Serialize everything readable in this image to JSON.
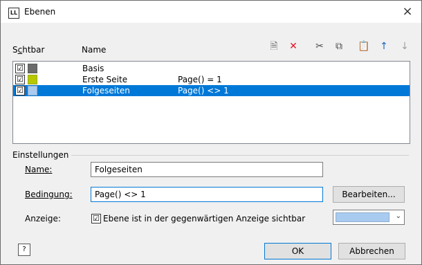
{
  "window": {
    "title": "Ebenen",
    "app_icon": "LL",
    "close": "×"
  },
  "columns": {
    "visible": "Sichtbar",
    "visible_mnemonic": "c",
    "name": "Name"
  },
  "toolbar": {
    "icons": [
      "new-layer-icon",
      "delete-icon",
      "cut-icon",
      "copy-icon",
      "paste-icon",
      "move-up-icon",
      "move-down-icon"
    ],
    "glyphs": [
      "🗎",
      "✕",
      "✂",
      "⧉",
      "📋",
      "↑",
      "↓"
    ],
    "colors": [
      "#6b6b6b",
      "#e81123",
      "#4a4a4a",
      "#4a4a4a",
      "#7a6a3a",
      "#1565c0",
      "#9e9e9e"
    ]
  },
  "layers": [
    {
      "checked": "☑",
      "color": "#6b6b6b",
      "name": "Basis",
      "condition": ""
    },
    {
      "checked": "☑",
      "color": "#b8c800",
      "name": "Erste Seite",
      "condition": "Page() = 1"
    },
    {
      "checked": "☑",
      "color": "#a9cbf0",
      "name": "Folgeseiten",
      "condition": "Page() <> 1"
    }
  ],
  "settings": {
    "group_label": "Einstellungen",
    "name_label": "Name:",
    "name_value": "Folgeseiten",
    "condition_label": "Bedingung:",
    "condition_value": "Page() <> 1",
    "edit_button": "Bearbeiten...",
    "display_label": "Anzeige:",
    "display_checkbox": "Ebene ist in der gegenwärtigen Anzeige sichtbar",
    "display_color": "#a9cbf0"
  },
  "footer": {
    "help": "?",
    "ok": "OK",
    "cancel": "Abbrechen"
  }
}
